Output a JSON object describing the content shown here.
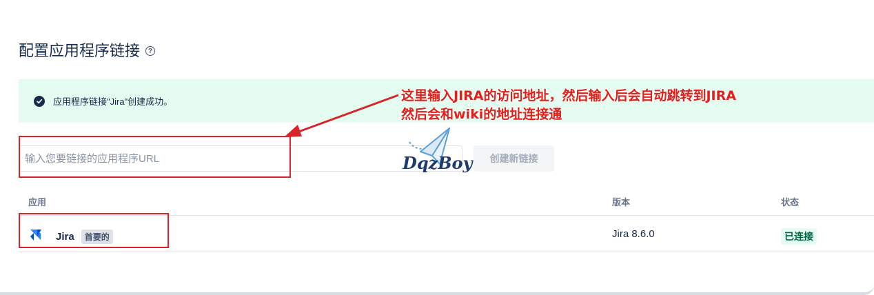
{
  "page": {
    "title": "配置应用程序链接"
  },
  "flag": {
    "message": "应用程序链接\"Jira\"创建成功。"
  },
  "url_form": {
    "placeholder": "输入您要链接的应用程序URL",
    "value": "",
    "create_button_label": "创建新链接"
  },
  "table": {
    "headers": {
      "app": "应用",
      "version": "版本",
      "status": "状态"
    },
    "rows": [
      {
        "app_name": "Jira",
        "badge": "首要的",
        "version": "Jira 8.6.0",
        "status": "已连接"
      }
    ]
  },
  "annotation": {
    "line1": "这里输入JIRA的访问地址，然后输入后会自动跳转到JIRA",
    "line2": "然后会和wiki的地址连接通"
  },
  "watermark": {
    "text": "DqzBoy"
  },
  "colors": {
    "success_bg": "#e3fcef",
    "success_text": "#006644",
    "annotation_red": "#d9252a",
    "jira_blue": "#2684ff"
  },
  "icons": {
    "help": "question-circle-icon",
    "success": "check-circle-icon",
    "jira": "jira-logo-icon"
  }
}
